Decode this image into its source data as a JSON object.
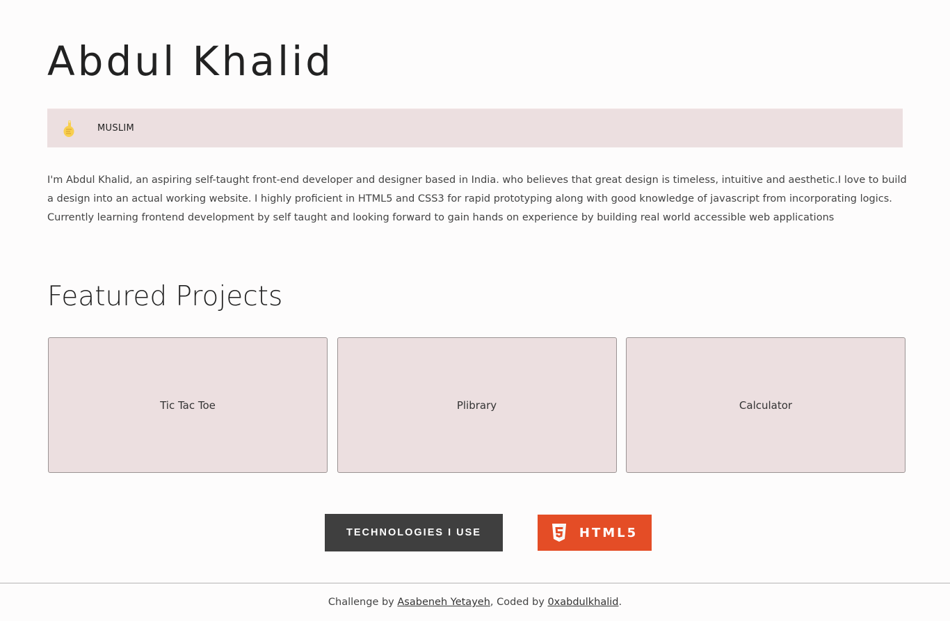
{
  "profile": {
    "name": "Abdul Khalid",
    "badge": {
      "icon": "pointing-up-hand-icon",
      "label": "MUSLIM"
    },
    "bio": "I'm Abdul Khalid, an aspiring self-taught front-end developer and designer based in India. who believes that great design is timeless, intuitive and aesthetic.I love to build a design into an actual working website. I highly proficient in HTML5 and CSS3 for rapid prototyping along with good knowledge of javascript from incorporating logics. Currently learning frontend development by self taught and looking forward to gain hands on experience by building real world accessible web applications"
  },
  "projects": {
    "title": "Featured Projects",
    "items": [
      {
        "name": "Tic Tac Toe"
      },
      {
        "name": "Plibrary"
      },
      {
        "name": "Calculator"
      }
    ]
  },
  "technologies": {
    "button_label": "TECHNOLOGIES I USE",
    "current": {
      "icon": "html5-icon",
      "label": "HTML5",
      "color": "#e44d26"
    }
  },
  "footer": {
    "prefix": "Challenge by ",
    "author_link": "Asabeneh Yetayeh",
    "middle": ", Coded by ",
    "coder_link": "0xabdulkhalid",
    "suffix": "."
  },
  "colors": {
    "card_background": "#ecdfe0",
    "button_dark": "#3f3f3f",
    "page_background": "#fdfcfc"
  }
}
